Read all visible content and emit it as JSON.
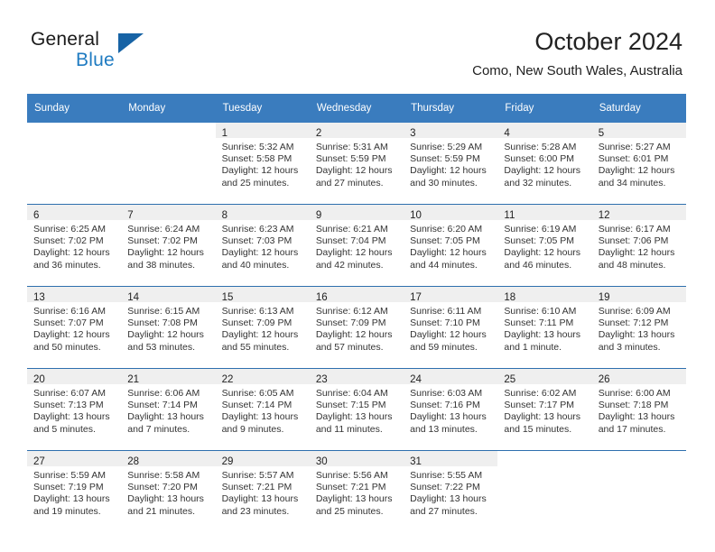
{
  "brand": {
    "name_part1": "General",
    "name_part2": "Blue",
    "triangle_color": "#1763a5",
    "blue_color": "#1f7bc1"
  },
  "header": {
    "title": "October 2024",
    "subtitle": "Como, New South Wales, Australia",
    "header_bg": "#3a7cbe",
    "row_divider_color": "#2e6fae",
    "daynum_band_bg": "#efefef"
  },
  "weekday_headers": [
    "Sunday",
    "Monday",
    "Tuesday",
    "Wednesday",
    "Thursday",
    "Friday",
    "Saturday"
  ],
  "weeks": [
    [
      {
        "day": "",
        "sunrise": "",
        "sunset": "",
        "daylight_line1": "",
        "daylight_line2": ""
      },
      {
        "day": "",
        "sunrise": "",
        "sunset": "",
        "daylight_line1": "",
        "daylight_line2": ""
      },
      {
        "day": "1",
        "sunrise": "Sunrise: 5:32 AM",
        "sunset": "Sunset: 5:58 PM",
        "daylight_line1": "Daylight: 12 hours",
        "daylight_line2": "and 25 minutes."
      },
      {
        "day": "2",
        "sunrise": "Sunrise: 5:31 AM",
        "sunset": "Sunset: 5:59 PM",
        "daylight_line1": "Daylight: 12 hours",
        "daylight_line2": "and 27 minutes."
      },
      {
        "day": "3",
        "sunrise": "Sunrise: 5:29 AM",
        "sunset": "Sunset: 5:59 PM",
        "daylight_line1": "Daylight: 12 hours",
        "daylight_line2": "and 30 minutes."
      },
      {
        "day": "4",
        "sunrise": "Sunrise: 5:28 AM",
        "sunset": "Sunset: 6:00 PM",
        "daylight_line1": "Daylight: 12 hours",
        "daylight_line2": "and 32 minutes."
      },
      {
        "day": "5",
        "sunrise": "Sunrise: 5:27 AM",
        "sunset": "Sunset: 6:01 PM",
        "daylight_line1": "Daylight: 12 hours",
        "daylight_line2": "and 34 minutes."
      }
    ],
    [
      {
        "day": "6",
        "sunrise": "Sunrise: 6:25 AM",
        "sunset": "Sunset: 7:02 PM",
        "daylight_line1": "Daylight: 12 hours",
        "daylight_line2": "and 36 minutes."
      },
      {
        "day": "7",
        "sunrise": "Sunrise: 6:24 AM",
        "sunset": "Sunset: 7:02 PM",
        "daylight_line1": "Daylight: 12 hours",
        "daylight_line2": "and 38 minutes."
      },
      {
        "day": "8",
        "sunrise": "Sunrise: 6:23 AM",
        "sunset": "Sunset: 7:03 PM",
        "daylight_line1": "Daylight: 12 hours",
        "daylight_line2": "and 40 minutes."
      },
      {
        "day": "9",
        "sunrise": "Sunrise: 6:21 AM",
        "sunset": "Sunset: 7:04 PM",
        "daylight_line1": "Daylight: 12 hours",
        "daylight_line2": "and 42 minutes."
      },
      {
        "day": "10",
        "sunrise": "Sunrise: 6:20 AM",
        "sunset": "Sunset: 7:05 PM",
        "daylight_line1": "Daylight: 12 hours",
        "daylight_line2": "and 44 minutes."
      },
      {
        "day": "11",
        "sunrise": "Sunrise: 6:19 AM",
        "sunset": "Sunset: 7:05 PM",
        "daylight_line1": "Daylight: 12 hours",
        "daylight_line2": "and 46 minutes."
      },
      {
        "day": "12",
        "sunrise": "Sunrise: 6:17 AM",
        "sunset": "Sunset: 7:06 PM",
        "daylight_line1": "Daylight: 12 hours",
        "daylight_line2": "and 48 minutes."
      }
    ],
    [
      {
        "day": "13",
        "sunrise": "Sunrise: 6:16 AM",
        "sunset": "Sunset: 7:07 PM",
        "daylight_line1": "Daylight: 12 hours",
        "daylight_line2": "and 50 minutes."
      },
      {
        "day": "14",
        "sunrise": "Sunrise: 6:15 AM",
        "sunset": "Sunset: 7:08 PM",
        "daylight_line1": "Daylight: 12 hours",
        "daylight_line2": "and 53 minutes."
      },
      {
        "day": "15",
        "sunrise": "Sunrise: 6:13 AM",
        "sunset": "Sunset: 7:09 PM",
        "daylight_line1": "Daylight: 12 hours",
        "daylight_line2": "and 55 minutes."
      },
      {
        "day": "16",
        "sunrise": "Sunrise: 6:12 AM",
        "sunset": "Sunset: 7:09 PM",
        "daylight_line1": "Daylight: 12 hours",
        "daylight_line2": "and 57 minutes."
      },
      {
        "day": "17",
        "sunrise": "Sunrise: 6:11 AM",
        "sunset": "Sunset: 7:10 PM",
        "daylight_line1": "Daylight: 12 hours",
        "daylight_line2": "and 59 minutes."
      },
      {
        "day": "18",
        "sunrise": "Sunrise: 6:10 AM",
        "sunset": "Sunset: 7:11 PM",
        "daylight_line1": "Daylight: 13 hours",
        "daylight_line2": "and 1 minute."
      },
      {
        "day": "19",
        "sunrise": "Sunrise: 6:09 AM",
        "sunset": "Sunset: 7:12 PM",
        "daylight_line1": "Daylight: 13 hours",
        "daylight_line2": "and 3 minutes."
      }
    ],
    [
      {
        "day": "20",
        "sunrise": "Sunrise: 6:07 AM",
        "sunset": "Sunset: 7:13 PM",
        "daylight_line1": "Daylight: 13 hours",
        "daylight_line2": "and 5 minutes."
      },
      {
        "day": "21",
        "sunrise": "Sunrise: 6:06 AM",
        "sunset": "Sunset: 7:14 PM",
        "daylight_line1": "Daylight: 13 hours",
        "daylight_line2": "and 7 minutes."
      },
      {
        "day": "22",
        "sunrise": "Sunrise: 6:05 AM",
        "sunset": "Sunset: 7:14 PM",
        "daylight_line1": "Daylight: 13 hours",
        "daylight_line2": "and 9 minutes."
      },
      {
        "day": "23",
        "sunrise": "Sunrise: 6:04 AM",
        "sunset": "Sunset: 7:15 PM",
        "daylight_line1": "Daylight: 13 hours",
        "daylight_line2": "and 11 minutes."
      },
      {
        "day": "24",
        "sunrise": "Sunrise: 6:03 AM",
        "sunset": "Sunset: 7:16 PM",
        "daylight_line1": "Daylight: 13 hours",
        "daylight_line2": "and 13 minutes."
      },
      {
        "day": "25",
        "sunrise": "Sunrise: 6:02 AM",
        "sunset": "Sunset: 7:17 PM",
        "daylight_line1": "Daylight: 13 hours",
        "daylight_line2": "and 15 minutes."
      },
      {
        "day": "26",
        "sunrise": "Sunrise: 6:00 AM",
        "sunset": "Sunset: 7:18 PM",
        "daylight_line1": "Daylight: 13 hours",
        "daylight_line2": "and 17 minutes."
      }
    ],
    [
      {
        "day": "27",
        "sunrise": "Sunrise: 5:59 AM",
        "sunset": "Sunset: 7:19 PM",
        "daylight_line1": "Daylight: 13 hours",
        "daylight_line2": "and 19 minutes."
      },
      {
        "day": "28",
        "sunrise": "Sunrise: 5:58 AM",
        "sunset": "Sunset: 7:20 PM",
        "daylight_line1": "Daylight: 13 hours",
        "daylight_line2": "and 21 minutes."
      },
      {
        "day": "29",
        "sunrise": "Sunrise: 5:57 AM",
        "sunset": "Sunset: 7:21 PM",
        "daylight_line1": "Daylight: 13 hours",
        "daylight_line2": "and 23 minutes."
      },
      {
        "day": "30",
        "sunrise": "Sunrise: 5:56 AM",
        "sunset": "Sunset: 7:21 PM",
        "daylight_line1": "Daylight: 13 hours",
        "daylight_line2": "and 25 minutes."
      },
      {
        "day": "31",
        "sunrise": "Sunrise: 5:55 AM",
        "sunset": "Sunset: 7:22 PM",
        "daylight_line1": "Daylight: 13 hours",
        "daylight_line2": "and 27 minutes."
      },
      {
        "day": "",
        "sunrise": "",
        "sunset": "",
        "daylight_line1": "",
        "daylight_line2": ""
      },
      {
        "day": "",
        "sunrise": "",
        "sunset": "",
        "daylight_line1": "",
        "daylight_line2": ""
      }
    ]
  ]
}
